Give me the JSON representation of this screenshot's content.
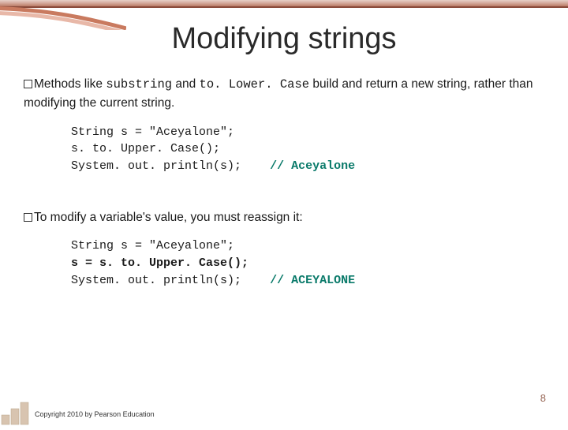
{
  "title": "Modifying strings",
  "bullet1": {
    "pre": "Methods like ",
    "code1": "substring",
    "mid": " and ",
    "code2": "to. Lower. Case",
    "post": " build and return a new string, rather than modifying the current string."
  },
  "code1": {
    "l1": "String s = \"Aceyalone\";",
    "l2": "s. to. Upper. Case();",
    "l3": "System. out. println(s);",
    "c3": "// Aceyalone"
  },
  "bullet2": "To modify a variable's value, you must reassign it:",
  "code2": {
    "l1": "String s = \"Aceyalone\";",
    "l2": "s = s. to. Upper. Case();",
    "l3": "System. out. println(s);",
    "c3": "// ACEYALONE"
  },
  "footer": "Copyright 2010 by Pearson Education",
  "page": "8"
}
